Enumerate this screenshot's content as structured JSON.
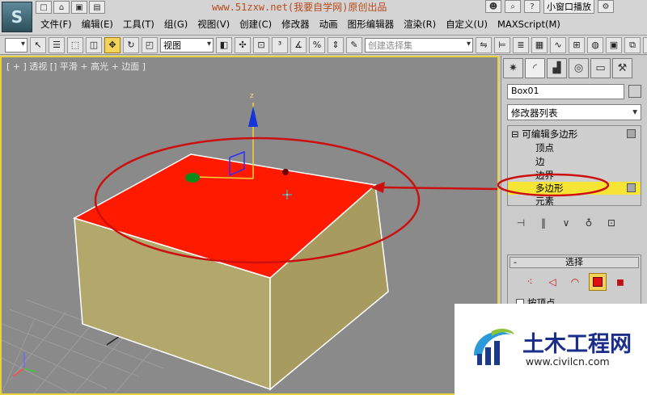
{
  "app": {
    "logo_glyph": "S",
    "banner_text": "www.51zxw.net(我要自学网)原创出品",
    "help_mode_label": "小窗口播放"
  },
  "menubar": {
    "items": [
      "文件(F)",
      "编辑(E)",
      "工具(T)",
      "组(G)",
      "视图(V)",
      "创建(C)",
      "修改器",
      "动画",
      "图形编辑器",
      "渲染(R)",
      "自定义(U)",
      "MAXScript(M)"
    ]
  },
  "toolbar": {
    "reference_coord": "视图",
    "named_selection_placeholder": "创建选择集"
  },
  "viewport": {
    "label": "[ + ] 透视 [] 平滑 + 高光 + 边面 ]",
    "gizmo_axis_label": "z",
    "colors": {
      "background": "#8a8a8a",
      "selected_face": "#ff1a00",
      "box_side": "#b5a86a",
      "active_border": "#e6d43a",
      "annotation": "#cc1010"
    }
  },
  "command_panel": {
    "tabs": [
      "create-icon",
      "modify-icon",
      "hierarchy-icon",
      "motion-icon",
      "display-icon",
      "utilities-icon"
    ],
    "object_name": "Box01",
    "modifier_list_label": "修改器列表",
    "stack": {
      "root": "可编辑多边形",
      "root_toggle": "⊟",
      "subobjects": [
        "顶点",
        "边",
        "边界",
        "多边形",
        "元素"
      ],
      "selected": "多边形"
    },
    "selection_rollout": {
      "title": "选择",
      "collapse": "-",
      "by_vertex_label": "按顶点"
    }
  },
  "watermark": {
    "title": "土木工程网",
    "url": "www.civilcn.com"
  }
}
